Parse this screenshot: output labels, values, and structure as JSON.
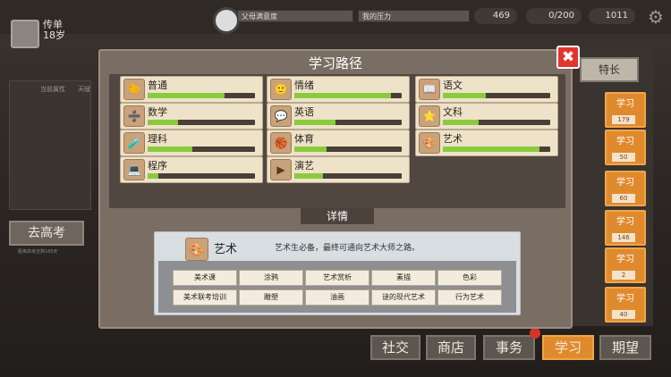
{
  "player": {
    "name": "传单",
    "age": "18岁"
  },
  "top_stats": {
    "parent_satisfaction": "父母满意度",
    "my_pressure": "我的压力",
    "money": "469",
    "energy": "0/200",
    "coins": "1011"
  },
  "left_panel": {
    "headers": [
      "当前属性",
      "天赋"
    ],
    "button": "去高考",
    "note": "距离高考还剩180天"
  },
  "right_column": {
    "tab": "特长",
    "items": [
      {
        "label": "学习",
        "count": "179"
      },
      {
        "label": "学习",
        "count": "50"
      },
      {
        "label": "学习",
        "count": "60"
      },
      {
        "label": "学习",
        "count": "146"
      },
      {
        "label": "学习",
        "count": "2"
      },
      {
        "label": "学习",
        "count": "40"
      }
    ]
  },
  "bottom_nav": [
    "社交",
    "商店",
    "事务",
    "学习",
    "期望"
  ],
  "modal": {
    "title": "学习路径",
    "close": "✖",
    "cards": [
      {
        "label": "普通",
        "icon": "🐤",
        "progress": 0.72
      },
      {
        "label": "情绪",
        "icon": "🙂",
        "progress": 0.9
      },
      {
        "label": "语文",
        "icon": "📖",
        "progress": 0.4
      },
      {
        "label": "数学",
        "icon": "➗",
        "progress": 0.28
      },
      {
        "label": "英语",
        "icon": "💬",
        "progress": 0.38
      },
      {
        "label": "文科",
        "icon": "⭐",
        "progress": 0.33
      },
      {
        "label": "理科",
        "icon": "🧪",
        "progress": 0.42
      },
      {
        "label": "体育",
        "icon": "🏀",
        "progress": 0.3
      },
      {
        "label": "艺术",
        "icon": "🎨",
        "progress": 0.9
      },
      {
        "label": "程序",
        "icon": "💻",
        "progress": 0.1
      },
      {
        "label": "演艺",
        "icon": "▶",
        "progress": 0.27
      }
    ],
    "detail_header": "详情",
    "detail": {
      "icon": "🎨",
      "name": "艺术",
      "description": "艺术生必备，最终可通向艺术大师之路。",
      "tags": [
        "美术课",
        "涂鸦",
        "艺术赏析",
        "素描",
        "色彩",
        "美术联考培训",
        "雕塑",
        "油画",
        "谜的现代艺术",
        "行为艺术"
      ]
    }
  }
}
